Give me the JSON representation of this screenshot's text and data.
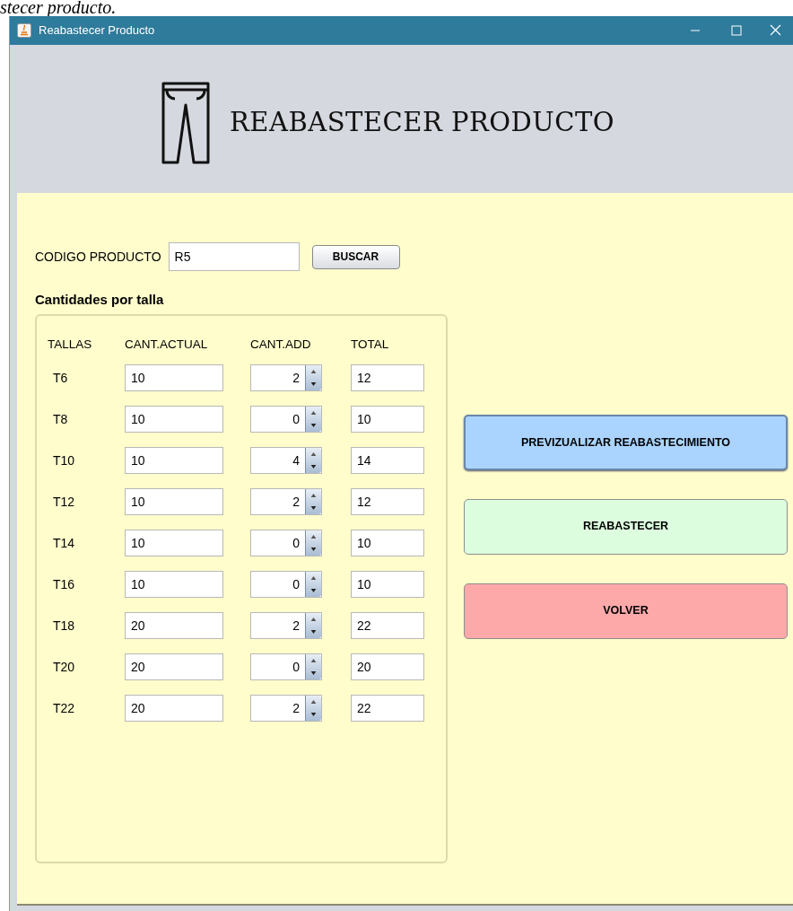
{
  "caption": "stecer producto.",
  "window": {
    "title": "Reabastecer Producto"
  },
  "header": {
    "title": "REABASTECER PRODUCTO"
  },
  "search": {
    "label": "CODIGO PRODUCTO",
    "value": "R5",
    "button": "BUSCAR"
  },
  "group": {
    "title": "Cantidades por talla",
    "columns": [
      "TALLAS",
      "CANT.ACTUAL",
      "CANT.ADD",
      "TOTAL"
    ],
    "rows": [
      {
        "size": "T6",
        "current": "10",
        "add": "2",
        "total": "12"
      },
      {
        "size": "T8",
        "current": "10",
        "add": "0",
        "total": "10"
      },
      {
        "size": "T10",
        "current": "10",
        "add": "4",
        "total": "14"
      },
      {
        "size": "T12",
        "current": "10",
        "add": "2",
        "total": "12"
      },
      {
        "size": "T14",
        "current": "10",
        "add": "0",
        "total": "10"
      },
      {
        "size": "T16",
        "current": "10",
        "add": "0",
        "total": "10"
      },
      {
        "size": "T18",
        "current": "20",
        "add": "2",
        "total": "22"
      },
      {
        "size": "T20",
        "current": "20",
        "add": "0",
        "total": "20"
      },
      {
        "size": "T22",
        "current": "20",
        "add": "2",
        "total": "22"
      }
    ]
  },
  "actions": [
    {
      "label": "PREVIZUALIZAR REABASTECIMIENTO",
      "color": "#aad4fe",
      "selected": true
    },
    {
      "label": "REABASTECER",
      "color": "#ddfddf",
      "selected": false
    },
    {
      "label": "VOLVER",
      "color": "#fda9a9",
      "selected": false
    }
  ]
}
